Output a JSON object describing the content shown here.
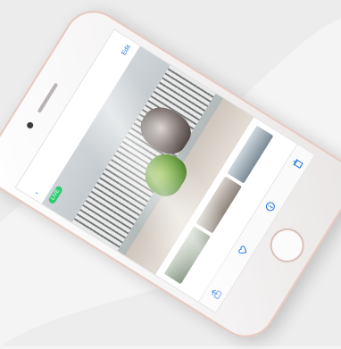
{
  "scene": {
    "background_color": "#f4f4f4",
    "phone_color": "#ffffff",
    "phone_trim_color": "#e7c9bf"
  },
  "screen": {
    "status": {
      "time": "",
      "battery": ""
    },
    "nav": {
      "back_label": "‹",
      "title": "",
      "action_label": "Edit"
    },
    "badge": {
      "label": "LIVE",
      "color": "#2ecc71"
    },
    "toolbar": {
      "icons": [
        "share-icon",
        "favorite-icon",
        "info-icon",
        "trash-icon"
      ]
    }
  }
}
